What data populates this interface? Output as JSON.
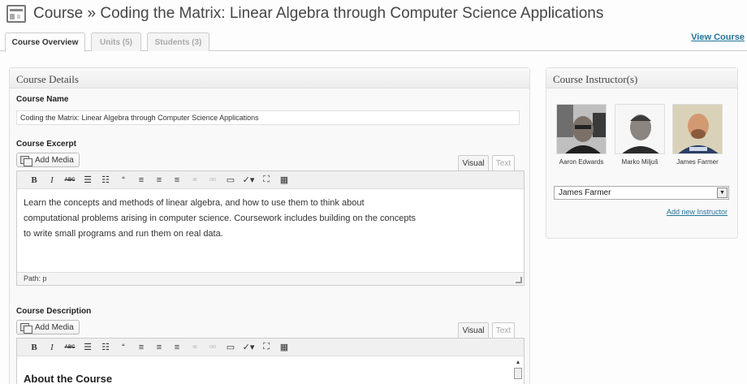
{
  "page": {
    "title": "Course » Coding the Matrix: Linear Algebra through Computer Science Applications",
    "view_link": "View Course"
  },
  "tabs": [
    {
      "label": "Course Overview",
      "active": true
    },
    {
      "label": "Units (5)",
      "active": false
    },
    {
      "label": "Students (3)",
      "active": false
    }
  ],
  "details": {
    "heading": "Course Details",
    "name_label": "Course Name",
    "name_value": "Coding the Matrix: Linear Algebra through Computer Science Applications",
    "excerpt_label": "Course Excerpt",
    "description_label": "Course Description",
    "add_media": "Add Media",
    "visual_tab": "Visual",
    "text_tab": "Text",
    "excerpt_lines": [
      "Learn the concepts and methods of linear algebra, and how to use them to think about",
      "computational problems arising in computer science. Coursework includes building on the concepts",
      "to write small programs and run them on real data."
    ],
    "path_label": "Path: p",
    "description_heading": "About the Course"
  },
  "toolbar_icons": [
    "bold-icon",
    "italic-icon",
    "strikethrough-icon",
    "bullet-list-icon",
    "numbered-list-icon",
    "blockquote-icon",
    "align-left-icon",
    "align-center-icon",
    "align-right-icon",
    "link-icon",
    "unlink-icon",
    "more-tag-icon",
    "spellcheck-icon",
    "fullscreen-icon",
    "kitchen-sink-icon"
  ],
  "instructors": {
    "heading": "Course Instructor(s)",
    "people": [
      {
        "name": "Aaron Edwards"
      },
      {
        "name": "Marko Miljuš"
      },
      {
        "name": "James Farmer"
      }
    ],
    "selected": "James Farmer",
    "add_link": "Add new Instructor"
  },
  "colors": {
    "link": "#21759b",
    "panel_bg": "#f9f9f9",
    "border": "#dfdfdf"
  }
}
